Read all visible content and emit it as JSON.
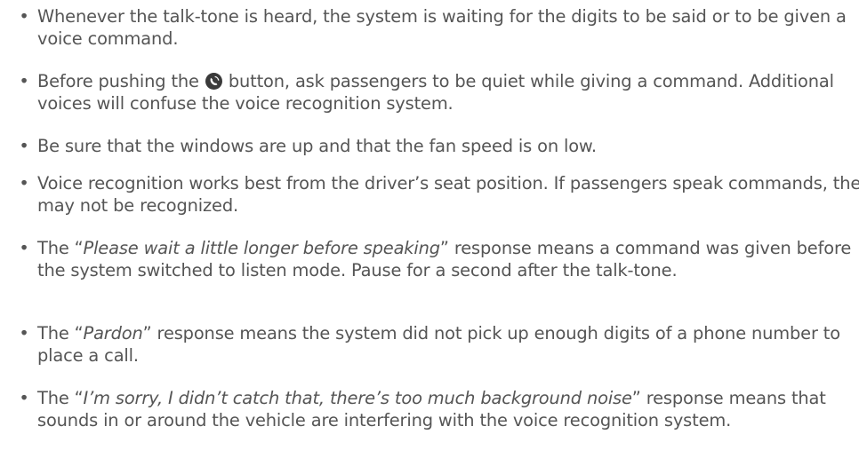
{
  "bullet_char": "•",
  "items": [
    {
      "text": "Whenever the talk-tone is heard, the system is waiting for the digits to be said or to be given a voice command."
    },
    {
      "before": "Before pushing the ",
      "icon": "voice-command-button-icon",
      "after": " button, ask passengers to be quiet while giving a command. Additional voices will confuse the voice recognition system."
    },
    {
      "text": "Be sure that the windows are up and that the fan speed is on low."
    },
    {
      "text": "Voice recognition works best from the driver’s seat position. If passengers speak commands, they may not be recognized."
    },
    {
      "before": "The “",
      "italic": "Please wait a little longer before speaking",
      "after": "” response means a command was given before the system switched to listen mode. Pause for a second after the talk-tone."
    },
    {
      "before": "The “",
      "italic": "Pardon",
      "after": "” response means the system did not pick up enough digits of a phone number to place a call."
    },
    {
      "before": "The “",
      "italic": "I’m sorry, I didn’t catch that, there’s too much background noise",
      "after": "” response means that sounds in or around the vehicle are interfering with the voice recognition system."
    }
  ],
  "colors": {
    "text": "#555555",
    "icon_fill": "#3a3a3a"
  }
}
